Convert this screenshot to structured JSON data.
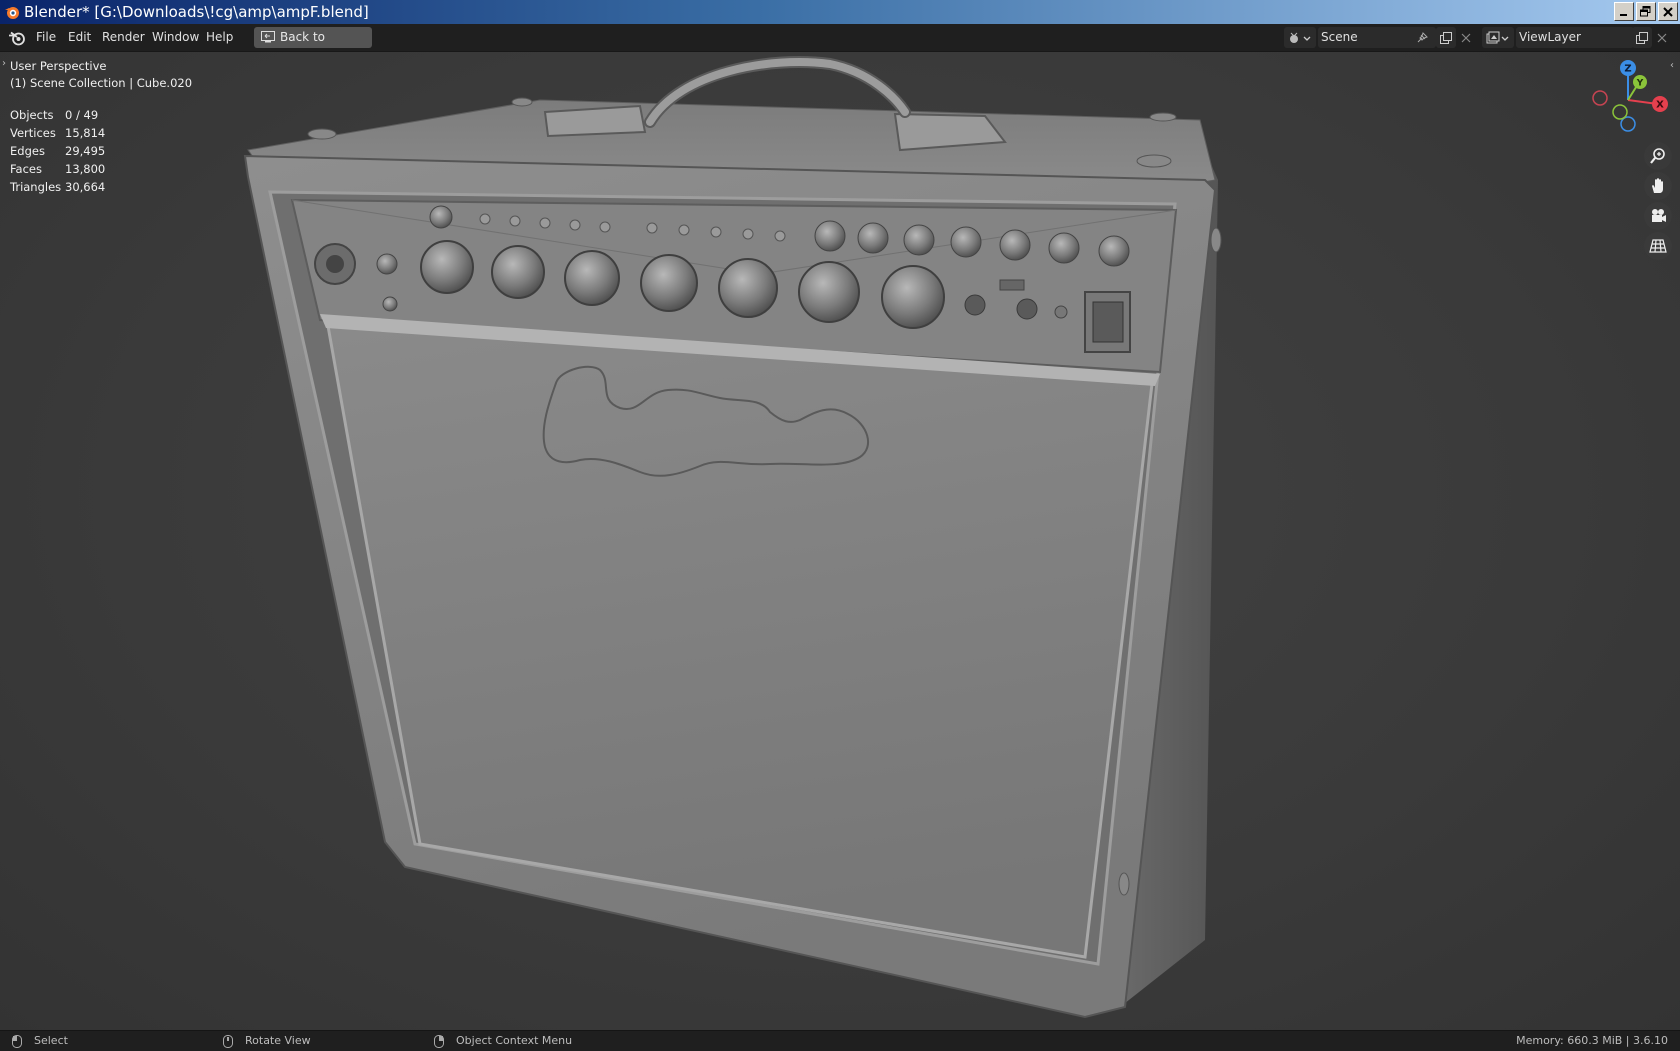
{
  "window": {
    "title": "Blender* [G:\\Downloads\\!cg\\amp\\ampF.blend]",
    "minimize_icon": "minimize-icon",
    "maximize_icon": "restore-icon",
    "close_icon": "close-icon"
  },
  "topbar": {
    "menu": [
      "File",
      "Edit",
      "Render",
      "Window",
      "Help"
    ],
    "back_button": "Back to Previous",
    "scene": {
      "label": "Scene"
    },
    "view_layer": {
      "label": "ViewLayer"
    }
  },
  "viewport": {
    "perspective": "User Perspective",
    "collection": "(1) Scene Collection | Cube.020",
    "stats": [
      {
        "label": "Objects",
        "value": "0 / 49"
      },
      {
        "label": "Vertices",
        "value": "15,814"
      },
      {
        "label": "Edges",
        "value": "29,495"
      },
      {
        "label": "Faces",
        "value": "13,800"
      },
      {
        "label": "Triangles",
        "value": "30,664"
      }
    ],
    "gizmo": {
      "x": "X",
      "y": "Y",
      "z": "Z"
    },
    "nav_icons": [
      "zoom-icon",
      "hand-pan-icon",
      "camera-icon",
      "ortho-grid-icon"
    ],
    "colors": {
      "x_axis": "#e5404e",
      "y_axis": "#8bc43a",
      "z_axis": "#3b8ee6"
    }
  },
  "statusbar": {
    "select": "Select",
    "rotate": "Rotate View",
    "context_menu": "Object Context Menu",
    "memory": "Memory: 660.3 MiB | 3.6.10"
  }
}
